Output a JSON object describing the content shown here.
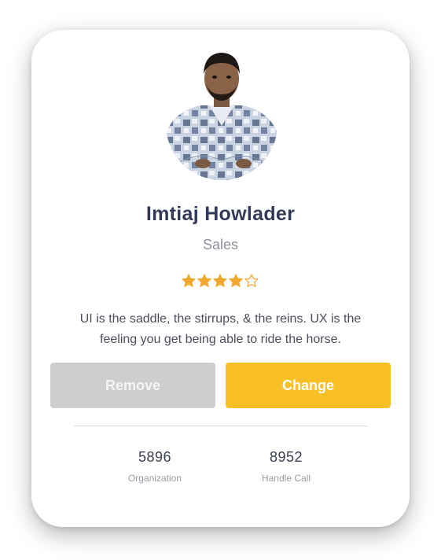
{
  "profile": {
    "name": "Imtiaj Howlader",
    "role": "Sales",
    "bio": "UI is the saddle, the stirrups, & the reins. UX is the feeling you get being able to ride the horse.",
    "rating": 4,
    "rating_max": 5
  },
  "actions": {
    "remove_label": "Remove",
    "change_label": "Change"
  },
  "stats": [
    {
      "value": "5896",
      "label": "Organization"
    },
    {
      "value": "8952",
      "label": "Handle Call"
    }
  ],
  "colors": {
    "accent": "#f9bf26",
    "star": "#f0a830",
    "remove": "#cecece",
    "name": "#343a56"
  },
  "icons": {
    "star_filled": "star-filled-icon",
    "star_empty": "star-outline-icon"
  }
}
